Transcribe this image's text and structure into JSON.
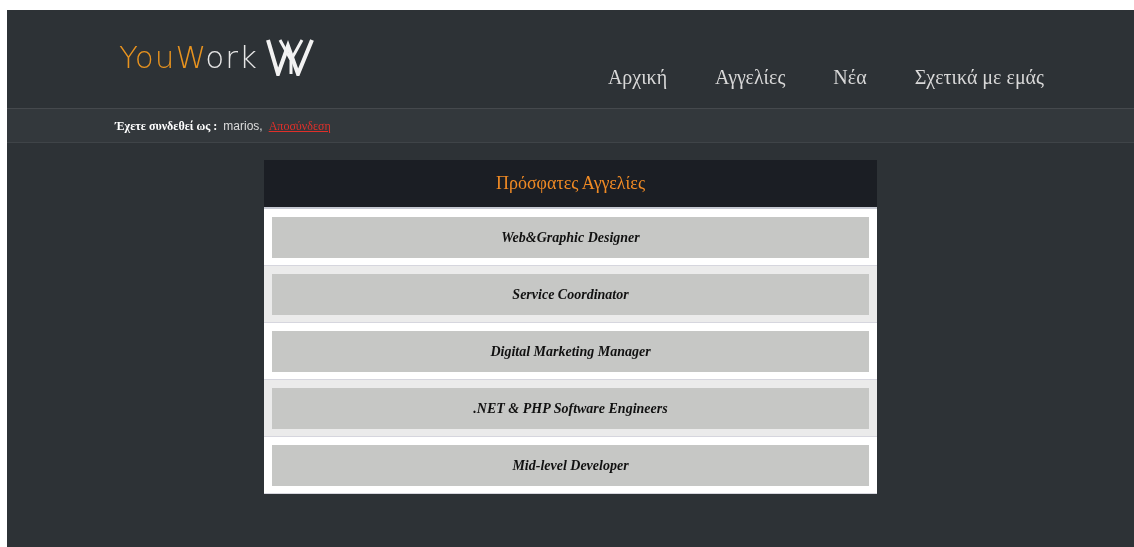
{
  "logo": {
    "parts": [
      {
        "text": "You",
        "accent": true
      },
      {
        "text": "W",
        "accent": true
      },
      {
        "text": "ork",
        "accent": false
      }
    ]
  },
  "nav": [
    {
      "label": "Αρχική"
    },
    {
      "label": "Αγγελίες"
    },
    {
      "label": "Νέα"
    },
    {
      "label": "Σχετικά με εμάς"
    }
  ],
  "session": {
    "label": "Έχετε συνδεθεί ως :",
    "user": "marios,",
    "logout": "Αποσύνδεση"
  },
  "jobs": {
    "title": "Πρόσφατες Αγγελίες",
    "items": [
      {
        "title": "Web&Graphic Designer"
      },
      {
        "title": "Service Coordinator"
      },
      {
        "title": "Digital Marketing Manager"
      },
      {
        "title": ".NET & PHP Software Engineers"
      },
      {
        "title": "Mid-level Developer"
      }
    ]
  }
}
